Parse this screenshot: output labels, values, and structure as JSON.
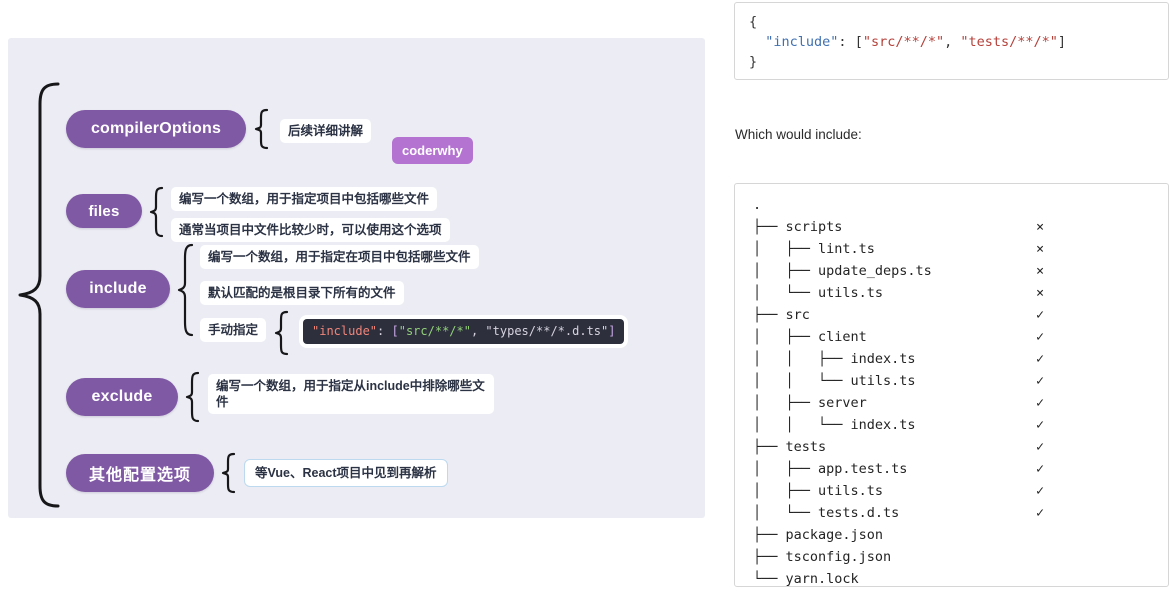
{
  "mindmap": {
    "author_badge": "coderwhy",
    "branches": [
      {
        "id": "compilerOptions",
        "label": "compilerOptions",
        "notes": [
          "后续详细讲解"
        ]
      },
      {
        "id": "files",
        "label": "files",
        "notes": [
          "编写一个数组，用于指定项目中包括哪些文件",
          "通常当项目中文件比较少时，可以使用这个选项"
        ]
      },
      {
        "id": "include",
        "label": "include",
        "notes": [
          "编写一个数组，用于指定在项目中包括哪些文件",
          "默认匹配的是根目录下所有的文件",
          "手动指定"
        ],
        "code_snippet": {
          "key": "\"include\"",
          "colon": ": ",
          "open": "[",
          "str1": "\"src/**/*\"",
          "comma": ", ",
          "str2": "\"types/**/*.d.ts\"",
          "close": "]"
        }
      },
      {
        "id": "exclude",
        "label": "exclude",
        "notes": [
          "编写一个数组，用于指定从include中排除哪些文件"
        ]
      },
      {
        "id": "other",
        "label": "其他配置选项",
        "notes": [
          "等Vue、React项目中见到再解析"
        ]
      }
    ]
  },
  "article": {
    "json_example": {
      "line1": "{",
      "indent": "  ",
      "key": "\"include\"",
      "colon": ": ",
      "open": "[",
      "str1": "\"src/**/*\"",
      "comma": ", ",
      "str2": "\"tests/**/*\"",
      "close": "]",
      "line3": "}"
    },
    "which_would_include": "Which would include:",
    "file_tree": [
      {
        "prefix": ".",
        "name": "",
        "mark": ""
      },
      {
        "prefix": "├── ",
        "name": "scripts",
        "mark": "×"
      },
      {
        "prefix": "│   ├── ",
        "name": "lint.ts",
        "mark": "×"
      },
      {
        "prefix": "│   ├── ",
        "name": "update_deps.ts",
        "mark": "×"
      },
      {
        "prefix": "│   └── ",
        "name": "utils.ts",
        "mark": "×"
      },
      {
        "prefix": "├── ",
        "name": "src",
        "mark": "✓"
      },
      {
        "prefix": "│   ├── ",
        "name": "client",
        "mark": "✓"
      },
      {
        "prefix": "│   │   ├── ",
        "name": "index.ts",
        "mark": "✓"
      },
      {
        "prefix": "│   │   └── ",
        "name": "utils.ts",
        "mark": "✓"
      },
      {
        "prefix": "│   ├── ",
        "name": "server",
        "mark": "✓"
      },
      {
        "prefix": "│   │   └── ",
        "name": "index.ts",
        "mark": "✓"
      },
      {
        "prefix": "├── ",
        "name": "tests",
        "mark": "✓"
      },
      {
        "prefix": "│   ├── ",
        "name": "app.test.ts",
        "mark": "✓"
      },
      {
        "prefix": "│   ├── ",
        "name": "utils.ts",
        "mark": "✓"
      },
      {
        "prefix": "│   └── ",
        "name": "tests.d.ts",
        "mark": "✓"
      },
      {
        "prefix": "├── ",
        "name": "package.json",
        "mark": ""
      },
      {
        "prefix": "├── ",
        "name": "tsconfig.json",
        "mark": ""
      },
      {
        "prefix": "└── ",
        "name": "yarn.lock",
        "mark": ""
      }
    ]
  },
  "colors": {
    "node_purple": "#8059a5",
    "badge_purple": "#b473d1",
    "canvas_bg": "#ecedf4",
    "chip_text": "#2b3243",
    "chip_border_blue": "#bcd9ef",
    "code_bg": "#2d2f3c",
    "json_key_blue": "#4070b0",
    "json_string_red": "#b5413a"
  }
}
